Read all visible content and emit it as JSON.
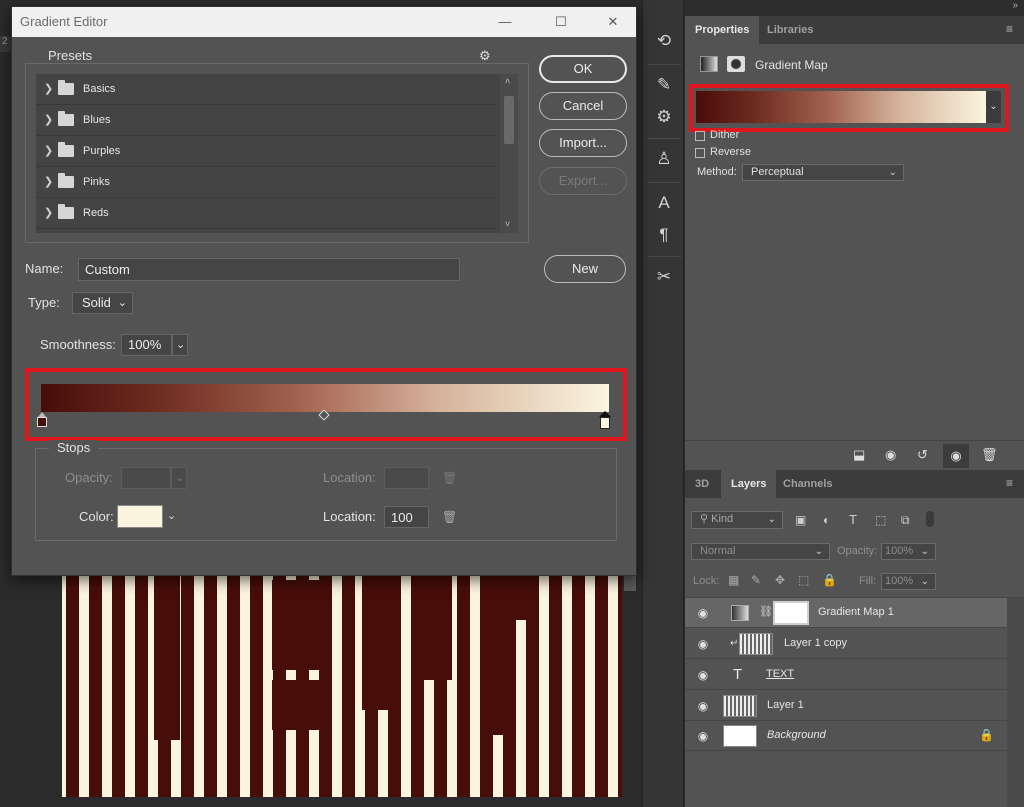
{
  "dialog": {
    "title": "Gradient Editor",
    "presets_label": "Presets",
    "presets": [
      "Basics",
      "Blues",
      "Purples",
      "Pinks",
      "Reds"
    ],
    "buttons": {
      "ok": "OK",
      "cancel": "Cancel",
      "import": "Import...",
      "export": "Export...",
      "new": "New"
    },
    "name_label": "Name:",
    "name_value": "Custom",
    "type_label": "Type:",
    "type_value": "Solid",
    "smoothness_label": "Smoothness:",
    "smoothness_value": "100%",
    "stops": {
      "title": "Stops",
      "opacity_label": "Opacity:",
      "location_label": "Location:",
      "color_label": "Color:",
      "location_value": "100"
    },
    "gradient_colors": [
      "#470d09",
      "#fbf5df"
    ]
  },
  "properties_panel": {
    "tabs": [
      "Properties",
      "Libraries"
    ],
    "title": "Gradient Map",
    "dither_label": "Dither",
    "reverse_label": "Reverse",
    "method_label": "Method:",
    "method_value": "Perceptual"
  },
  "layers_panel": {
    "tabs": [
      "3D",
      "Layers",
      "Channels"
    ],
    "kind_placeholder": "Kind",
    "blend_mode": "Normal",
    "opacity_label": "Opacity:",
    "opacity_value": "100%",
    "lock_label": "Lock:",
    "fill_label": "Fill:",
    "fill_value": "100%",
    "layers": [
      {
        "name": "Gradient Map 1",
        "selected": true
      },
      {
        "name": "Layer 1 copy"
      },
      {
        "name": "TEXT"
      },
      {
        "name": "Layer 1"
      },
      {
        "name": "Background"
      }
    ]
  },
  "colors": {
    "accent_red": "#e0161c",
    "dark_stop": "#470d09",
    "light_stop": "#fbf5df",
    "panel_bg": "#535353"
  }
}
